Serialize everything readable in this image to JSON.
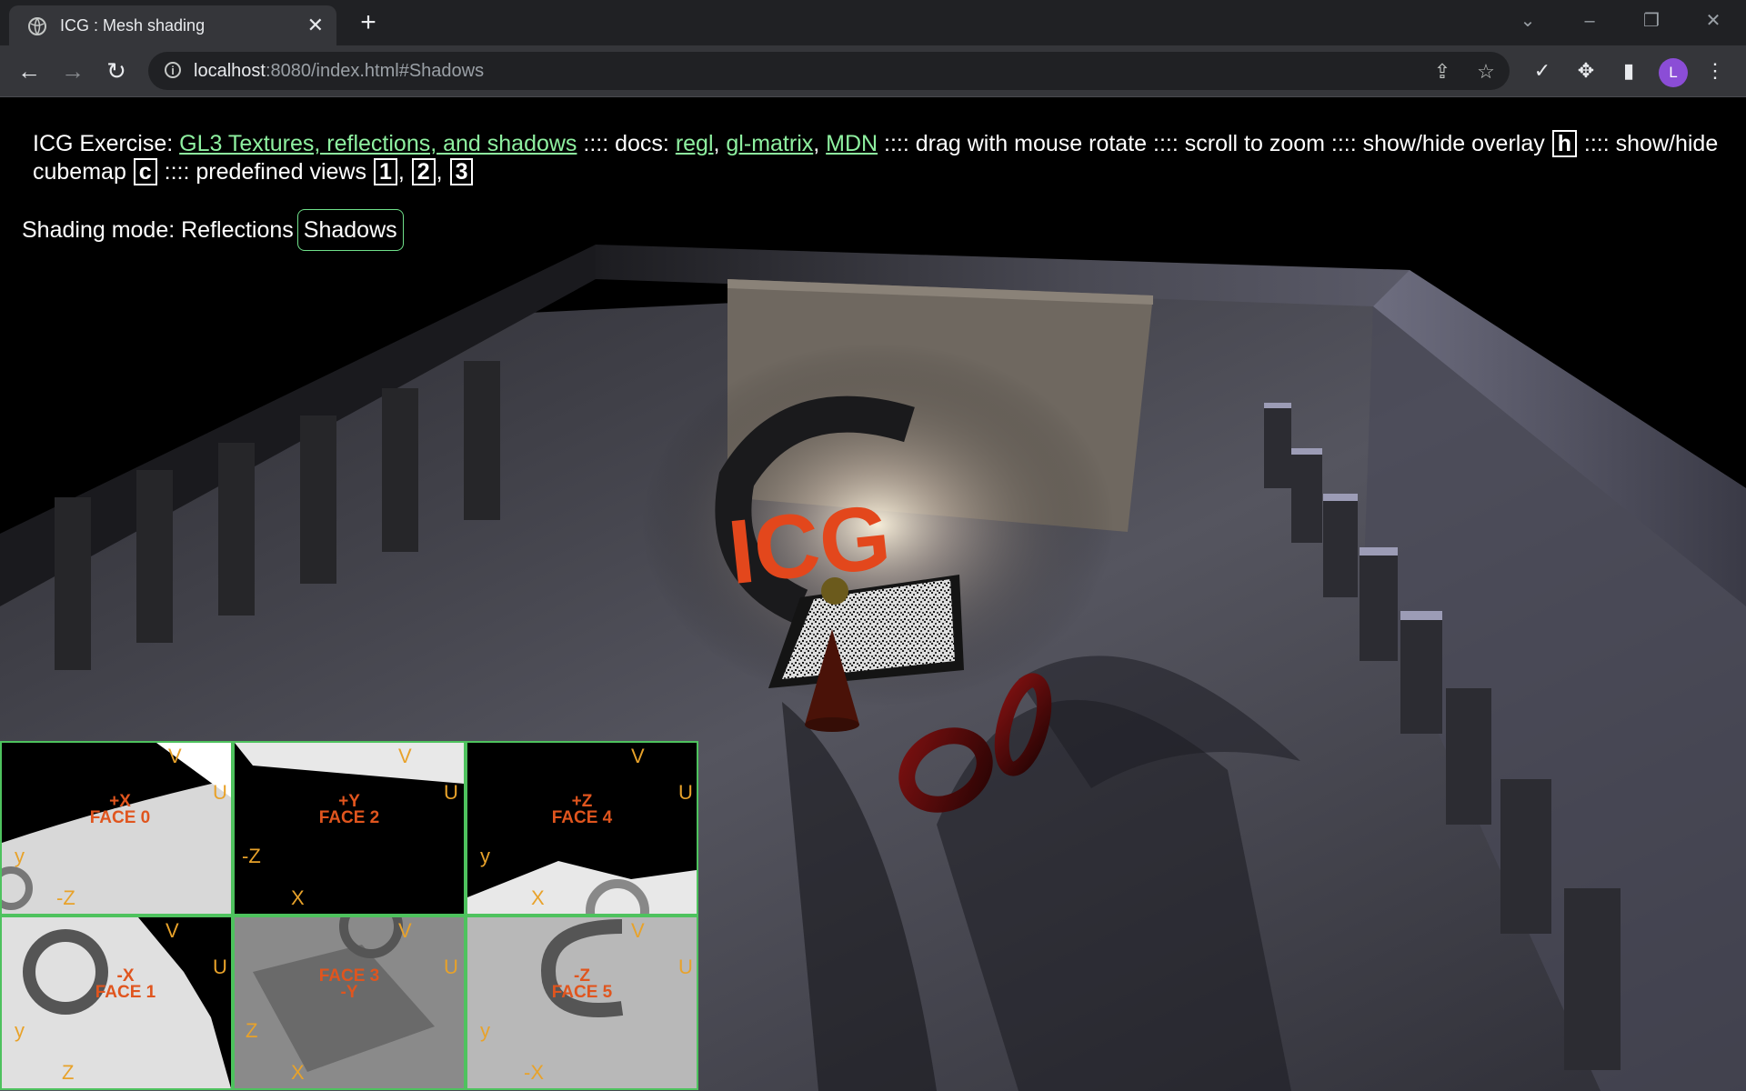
{
  "browser": {
    "tab_title": "ICG : Mesh shading",
    "url_host": "localhost",
    "url_rest": ":8080/index.html#Shadows",
    "profile_initial": "L"
  },
  "overlay": {
    "prefix": "ICG Exercise: ",
    "exercise_link": "GL3 Textures, reflections, and shadows",
    "docs_sep": " :::: docs: ",
    "doc_regl": "regl",
    "doc_glmatrix": "gl-matrix",
    "doc_mdn": "MDN",
    "rotate_text": " :::: drag with mouse rotate :::: scroll to zoom :::: show/hide overlay ",
    "key_h": "h",
    "cubemap_text": " :::: show/hide cubemap ",
    "key_c": "c",
    "views_text": " :::: predefined views ",
    "key_1": "1",
    "key_2": "2",
    "key_3": "3",
    "comma": ", "
  },
  "shading": {
    "label": "Shading mode: ",
    "option_reflections": "Reflections",
    "option_shadows": "Shadows"
  },
  "scene": {
    "title_text": "ICG"
  },
  "cubemap_faces": [
    {
      "name": "+X",
      "face": "FACE 0",
      "v": "V",
      "u": "U",
      "a1": "y",
      "a2": "-Z"
    },
    {
      "name": "+Y",
      "face": "FACE 2",
      "v": "V",
      "u": "U",
      "a1": "-Z",
      "a2": "X"
    },
    {
      "name": "+Z",
      "face": "FACE 4",
      "v": "V",
      "u": "U",
      "a1": "y",
      "a2": "X"
    },
    {
      "name": "-X",
      "face": "FACE 1",
      "v": "V",
      "u": "U",
      "a1": "y",
      "a2": "Z"
    },
    {
      "name": "-Y",
      "face": "FACE 3",
      "v": "V",
      "u": "U",
      "a1": "Z",
      "a2": "X"
    },
    {
      "name": "-Z",
      "face": "FACE 5",
      "v": "V",
      "u": "U",
      "a1": "y",
      "a2": "-X"
    }
  ]
}
